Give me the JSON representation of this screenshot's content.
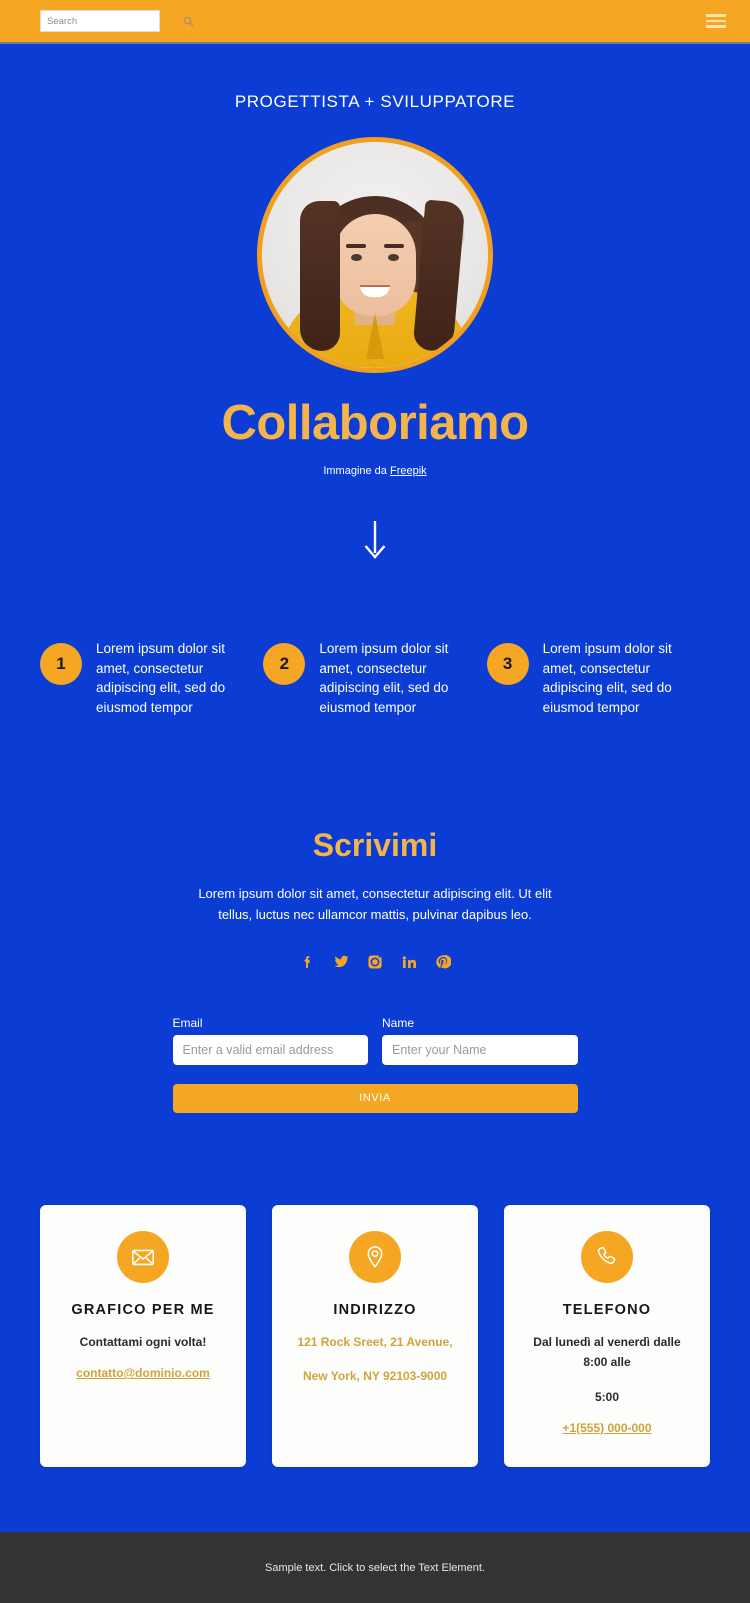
{
  "topbar": {
    "search": {
      "placeholder": "Search",
      "value": "",
      "icon": "search-icon"
    },
    "menu_icon": "hamburger-menu-icon",
    "bar_color": "#F5A623"
  },
  "hero": {
    "kicker": "PROGETTISTA + SVILUPPATORE",
    "portrait_alt": "portrait-photo",
    "title": "Collaboriamo",
    "credit_prefix": "Immagine da ",
    "credit_link": "Freepik",
    "scroll_icon": "down-arrow-icon",
    "background_color": "#0B3DD4",
    "accent_color": "#F3B44B"
  },
  "steps": [
    {
      "number": "1",
      "text": "Lorem ipsum dolor sit amet, consectetur adipiscing elit, sed do eiusmod tempor"
    },
    {
      "number": "2",
      "text": "Lorem ipsum dolor sit amet, consectetur adipiscing elit, sed do eiusmod tempor"
    },
    {
      "number": "3",
      "text": "Lorem ipsum dolor sit amet, consectetur adipiscing elit, sed do eiusmod tempor"
    }
  ],
  "contact_section": {
    "title": "Scrivimi",
    "subtitle": "Lorem ipsum dolor sit amet, consectetur adipiscing elit. Ut elit tellus, luctus nec ullamcor mattis, pulvinar dapibus leo.",
    "socials": [
      {
        "name": "facebook-icon",
        "label": "Facebook"
      },
      {
        "name": "twitter-icon",
        "label": "Twitter"
      },
      {
        "name": "instagram-icon",
        "label": "Instagram"
      },
      {
        "name": "linkedin-icon",
        "label": "LinkedIn"
      },
      {
        "name": "pinterest-icon",
        "label": "Pinterest"
      }
    ],
    "form": {
      "email_label": "Email",
      "email_placeholder": "Enter a valid email address",
      "email_value": "",
      "name_label": "Name",
      "name_placeholder": "Enter your Name",
      "name_value": "",
      "submit_label": "INVIA"
    }
  },
  "cards": [
    {
      "icon": "envelope-icon",
      "title": "GRAFICO PER ME",
      "line1": "Contattami ogni volta!",
      "line2": "",
      "link": "contatto@dominio.com",
      "link_style": "gold"
    },
    {
      "icon": "location-pin-icon",
      "title": "INDIRIZZO",
      "line1": "121 Rock Sreet, 21 Avenue,",
      "line2": "New York, NY 92103-9000",
      "link": "",
      "link_style": "gold"
    },
    {
      "icon": "phone-icon",
      "title": "TELEFONO",
      "line1": "Dal lunedì al venerdì dalle 8:00 alle",
      "line2": "5:00",
      "link": "+1(555) 000-000",
      "link_style": "gold"
    }
  ],
  "footer": {
    "text": "Sample text. Click to select the Text Element.",
    "background_color": "#333333"
  }
}
